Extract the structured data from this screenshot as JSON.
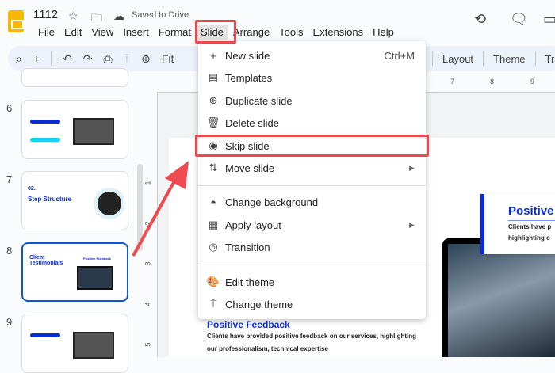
{
  "doc": {
    "title": "1112",
    "saved": "Saved to Drive"
  },
  "menubar": [
    "File",
    "Edit",
    "View",
    "Insert",
    "Format",
    "Slide",
    "Arrange",
    "Tools",
    "Extensions",
    "Help"
  ],
  "toolbar": {
    "zoom_label": "Fit",
    "right": [
      "Layout",
      "Theme",
      "Tra"
    ]
  },
  "filmstrip": {
    "numbers": [
      "6",
      "7",
      "8",
      "9"
    ],
    "slide7": {
      "num": "02.",
      "title": "Step Structure"
    },
    "slide8": {
      "title": "Client Testimonials",
      "card": "Positive Feedback"
    }
  },
  "vruler": [
    "1",
    "2",
    "3",
    "4",
    "5"
  ],
  "hruler": [
    "7",
    "8",
    "9"
  ],
  "slide": {
    "card_title": "Positive",
    "card_text1": "Clients have p",
    "card_text2": "highlighting o",
    "heading": "Positive Feedback",
    "body1": "Clients have provided positive feedback on our services, highlighting",
    "body2": "our professionalism, technical expertise",
    "accent": "#0b2bd6"
  },
  "menu": {
    "items": [
      {
        "icon": "plus-icon",
        "glyph": "+",
        "label": "New slide",
        "shortcut": "Ctrl+M"
      },
      {
        "icon": "templates-icon",
        "glyph": "▤",
        "label": "Templates"
      },
      {
        "icon": "duplicate-icon",
        "glyph": "⊕",
        "label": "Duplicate slide"
      },
      {
        "icon": "trash-icon",
        "glyph": "🗑",
        "label": "Delete slide"
      },
      {
        "icon": "eye-icon",
        "glyph": "◉",
        "label": "Skip slide"
      },
      {
        "icon": "move-icon",
        "glyph": "⇅",
        "label": "Move slide",
        "submenu": true
      },
      {
        "icon": "drop-icon",
        "glyph": "◓",
        "label": "Change background"
      },
      {
        "icon": "layout-icon",
        "glyph": "▦",
        "label": "Apply layout",
        "submenu": true
      },
      {
        "icon": "transition-icon",
        "glyph": "◎",
        "label": "Transition"
      },
      {
        "icon": "palette-icon",
        "glyph": "🎨",
        "label": "Edit theme"
      },
      {
        "icon": "paint-roller-icon",
        "glyph": "⍑",
        "label": "Change theme"
      }
    ]
  },
  "annotation_color": "#e9484f"
}
